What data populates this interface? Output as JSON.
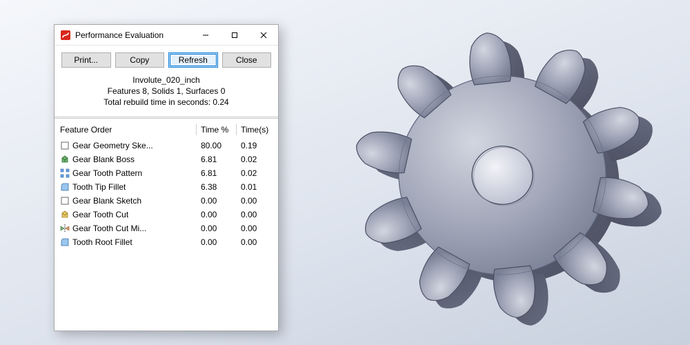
{
  "dialog": {
    "title": "Performance Evaluation",
    "app_icon": "solidworks-icon",
    "buttons": {
      "print": "Print...",
      "copy": "Copy",
      "refresh": "Refresh",
      "close": "Close"
    },
    "summary": {
      "line1": "Involute_020_inch",
      "line2": "Features 8, Solids 1, Surfaces 0",
      "line3": "Total rebuild time in seconds: 0.24"
    },
    "columns": {
      "feature": "Feature Order",
      "pct": "Time %",
      "time": "Time(s)"
    },
    "rows": [
      {
        "icon": "sketch-icon",
        "name": "Gear Geometry Ske...",
        "pct": "80.00",
        "time": "0.19"
      },
      {
        "icon": "boss-icon",
        "name": "Gear Blank Boss",
        "pct": "6.81",
        "time": "0.02"
      },
      {
        "icon": "pattern-icon",
        "name": "Gear Tooth Pattern",
        "pct": "6.81",
        "time": "0.02"
      },
      {
        "icon": "fillet-icon",
        "name": "Tooth Tip Fillet",
        "pct": "6.38",
        "time": "0.01"
      },
      {
        "icon": "sketch-icon",
        "name": "Gear Blank Sketch",
        "pct": "0.00",
        "time": "0.00"
      },
      {
        "icon": "cut-icon",
        "name": "Gear Tooth Cut",
        "pct": "0.00",
        "time": "0.00"
      },
      {
        "icon": "mirror-icon",
        "name": "Gear Tooth Cut Mi...",
        "pct": "0.00",
        "time": "0.00"
      },
      {
        "icon": "fillet-icon",
        "name": "Tooth Root Fillet",
        "pct": "0.00",
        "time": "0.00"
      }
    ]
  },
  "viewport": {
    "model_name": "Involute_020_inch",
    "teeth": 10
  },
  "colors": {
    "accent": "#0078d7"
  }
}
